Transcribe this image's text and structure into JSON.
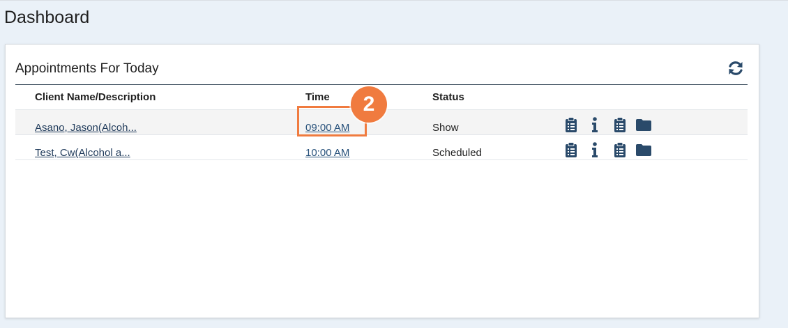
{
  "page": {
    "title": "Dashboard"
  },
  "panel": {
    "title": "Appointments For Today",
    "refresh_icon": "refresh-icon"
  },
  "table": {
    "columns": [
      "Client Name/Description",
      "Time",
      "Status"
    ],
    "rows": [
      {
        "client": "Asano, Jason(Alcoh...",
        "time": "09:00 AM",
        "status": "Show"
      },
      {
        "client": "Test, Cw(Alcohol a...",
        "time": "10:00 AM",
        "status": "Scheduled"
      }
    ],
    "row_icons": [
      "clipboard-list-icon",
      "info-icon",
      "clipboard-list-icon",
      "folder-icon"
    ]
  },
  "annotation": {
    "step_number": "2",
    "color": "#f07b3f"
  },
  "colors": {
    "icon": "#2a4a6a",
    "link": "#1f3a5a",
    "accent": "#f07b3f"
  }
}
